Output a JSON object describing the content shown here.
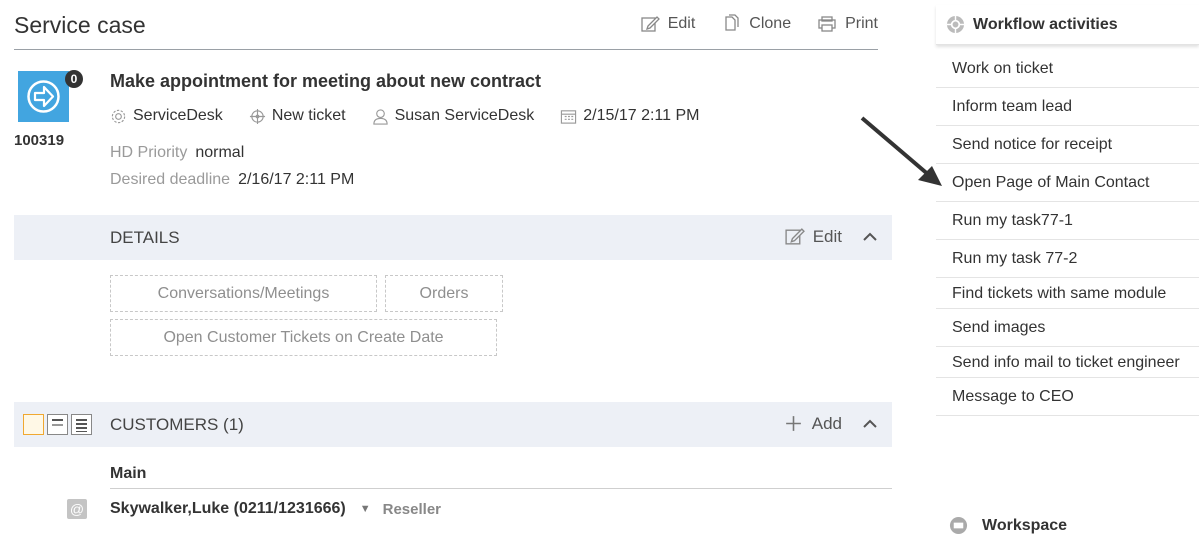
{
  "header": {
    "title": "Service case",
    "edit_label": "Edit",
    "clone_label": "Clone",
    "print_label": "Print"
  },
  "record": {
    "id": "100319",
    "badge": "0",
    "title": "Make appointment for meeting about new contract",
    "meta": {
      "service": "ServiceDesk",
      "status": "New ticket",
      "owner": "Susan ServiceDesk",
      "date": "2/15/17 2:11 PM"
    },
    "priority": {
      "label": "HD Priority",
      "value": "normal"
    },
    "deadline": {
      "label": "Desired deadline",
      "value": "2/16/17 2:11 PM"
    }
  },
  "details": {
    "title": "DETAILS",
    "action_label": "Edit",
    "tiles": [
      "Conversations/Meetings",
      "Orders",
      "Open Customer Tickets on Create Date"
    ]
  },
  "customers": {
    "title": "CUSTOMERS (1)",
    "action_label": "Add",
    "group_label": "Main",
    "contact": {
      "name": "Skywalker,Luke (0211/1231666)",
      "role": "Reseller",
      "icon_text": "@"
    }
  },
  "workflow": {
    "title": "Workflow activities",
    "items": [
      "Work on ticket",
      "Inform team lead",
      "Send notice for receipt",
      "Open Page of Main Contact",
      "Run my task77-1",
      "Run my task 77-2",
      "Find tickets with same module",
      "Send images",
      "Send info mail to ticket engineer",
      "Message to CEO"
    ]
  },
  "workspace": {
    "title": "Workspace"
  },
  "colors": {
    "accent": "#42a5e0",
    "section_bg": "#edf0f6",
    "toggle_active": "#f0a830"
  },
  "icons": [
    "edit-icon",
    "clone-icon",
    "print-icon",
    "gear-icon",
    "target-icon",
    "user-icon",
    "calendar-icon",
    "chevron-up-icon",
    "plus-icon",
    "email-icon",
    "arrow-annotation-icon"
  ]
}
